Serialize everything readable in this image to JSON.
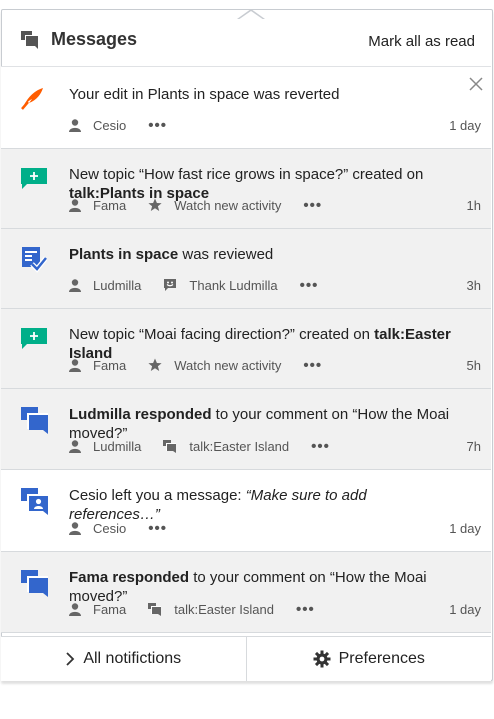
{
  "header": {
    "title": "Messages",
    "mark_all": "Mark all as read"
  },
  "notifications": [
    {
      "state": "read",
      "icon": "revert-icon",
      "segments": [
        {
          "t": "Your edit in Plants in space was reverted",
          "s": "n"
        }
      ],
      "user": "Cesio",
      "extra": "",
      "time": "1 day",
      "closable": true
    },
    {
      "state": "unread",
      "icon": "new-topic-icon",
      "segments": [
        {
          "t": "New topic “How fast rice grows in space?” created on ",
          "s": "n"
        },
        {
          "t": "talk:Plants in space",
          "s": "b"
        }
      ],
      "user": "Fama",
      "extra": "Watch new activity",
      "extra_icon": "star-icon",
      "time": "1h"
    },
    {
      "state": "unread",
      "icon": "reviewed-icon",
      "segments": [
        {
          "t": "Plants in space",
          "s": "b"
        },
        {
          "t": " was reviewed",
          "s": "n"
        }
      ],
      "user": "Ludmilla",
      "extra": "Thank Ludmilla",
      "extra_icon": "smile-icon",
      "time": "3h"
    },
    {
      "state": "unread",
      "icon": "new-topic-icon",
      "segments": [
        {
          "t": "New topic “Moai facing direction?” created on ",
          "s": "n"
        },
        {
          "t": "talk:Easter Island",
          "s": "b"
        }
      ],
      "user": "Fama",
      "extra": "Watch new activity",
      "extra_icon": "star-icon",
      "time": "5h"
    },
    {
      "state": "unread",
      "icon": "discussion-icon",
      "segments": [
        {
          "t": "Ludmilla responded",
          "s": "b"
        },
        {
          "t": " to your comment on “How the Moai moved?”",
          "s": "n"
        }
      ],
      "user": "Ludmilla",
      "extra": "talk:Easter Island",
      "extra_icon": "talk-page-icon",
      "time": "7h"
    },
    {
      "state": "read",
      "icon": "user-talk-icon",
      "segments": [
        {
          "t": "Cesio left you a message: ",
          "s": "n"
        },
        {
          "t": "“Make sure to add references…”",
          "s": "i"
        }
      ],
      "user": "Cesio",
      "extra": "",
      "time": "1 day"
    },
    {
      "state": "unread",
      "icon": "discussion-icon",
      "segments": [
        {
          "t": "Fama responded",
          "s": "b"
        },
        {
          "t": " to your comment on “How the Moai moved?”",
          "s": "n"
        }
      ],
      "user": "Fama",
      "extra": "talk:Easter Island",
      "extra_icon": "talk-page-icon",
      "time": "1 day"
    }
  ],
  "footer": {
    "all_label": "All notifictions",
    "prefs_label": "Preferences"
  },
  "colors": {
    "accent_blue": "#3366cc",
    "green": "#00af89",
    "orange": "#ff5d00",
    "unread_bg": "#f1f1f1"
  }
}
